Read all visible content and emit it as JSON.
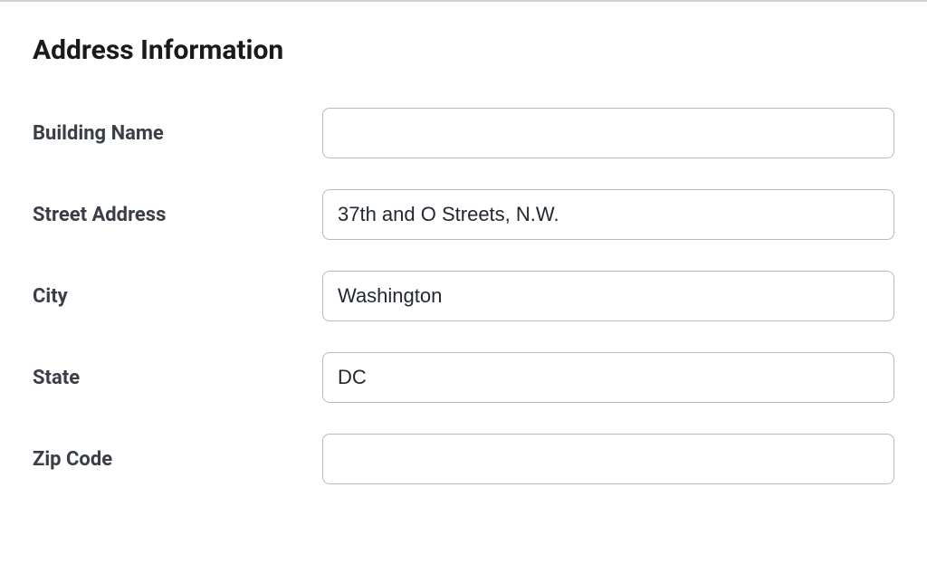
{
  "section": {
    "title": "Address Information"
  },
  "fields": {
    "building_name": {
      "label": "Building Name",
      "value": ""
    },
    "street_address": {
      "label": "Street Address",
      "value": "37th and O Streets, N.W."
    },
    "city": {
      "label": "City",
      "value": "Washington"
    },
    "state": {
      "label": "State",
      "value": "DC"
    },
    "zip_code": {
      "label": "Zip Code",
      "value": ""
    }
  }
}
